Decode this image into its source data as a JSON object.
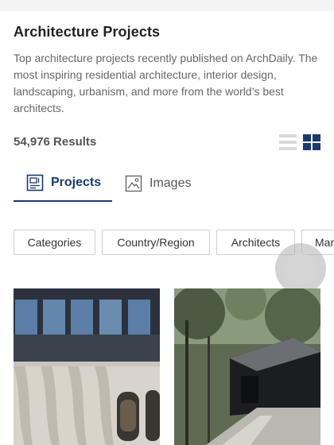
{
  "page": {
    "title": "Architecture Projects",
    "description": "Top architecture projects recently published on ArchDaily. The most inspiring residential architecture, interior design, landscaping, urbanism, and more from the world’s best architects.",
    "results_count": "54,976 Results"
  },
  "view_toggle": {
    "active": "grid",
    "list_icon": "list-view-icon",
    "grid_icon": "grid-view-icon"
  },
  "tabs": [
    {
      "label": "Projects",
      "icon": "blueprint-icon",
      "active": true
    },
    {
      "label": "Images",
      "icon": "image-icon",
      "active": false
    }
  ],
  "filters": [
    {
      "label": "Categories"
    },
    {
      "label": "Country/Region"
    },
    {
      "label": "Architects"
    },
    {
      "label": "Mar"
    }
  ],
  "colors": {
    "accent": "#1b3a6b",
    "text_primary": "#222222",
    "text_secondary": "#666666",
    "chip_border": "#cfcfcf",
    "toggle_inactive": "#d9d9d9"
  }
}
